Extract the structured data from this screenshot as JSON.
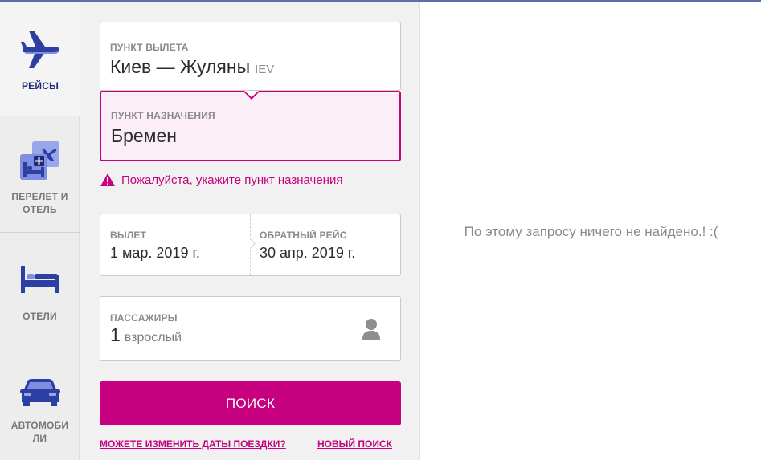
{
  "rail": {
    "tabs": [
      {
        "label": "РЕЙСЫ",
        "icon": "airplane-icon",
        "active": true
      },
      {
        "label": "ПЕРЕЛЕТ И ОТЕЛЬ",
        "icon": "flight-hotel-icon",
        "active": false
      },
      {
        "label": "ОТЕЛИ",
        "icon": "bed-icon",
        "active": false
      },
      {
        "label": "АВТОМОБИ ЛИ",
        "icon": "car-icon",
        "active": false
      }
    ]
  },
  "form": {
    "origin": {
      "label": "ПУНКТ ВЫЛЕТА",
      "value": "Киев — Жуляны",
      "code": "IEV"
    },
    "destination": {
      "label": "ПУНКТ НАЗНАЧЕНИЯ",
      "value": "Бремен"
    },
    "error": {
      "text": "Пожалуйста, укажите пункт назначения",
      "icon": "warning-icon"
    },
    "departure": {
      "label": "ВЫЛЕТ",
      "value": "1 мар. 2019 г."
    },
    "return": {
      "label": "ОБРАТНЫЙ РЕЙС",
      "value": "30 апр. 2019 г."
    },
    "passengers": {
      "label": "ПАССАЖИРЫ",
      "count": "1",
      "unit": "взрослый",
      "icon": "person-icon"
    },
    "search_label": "ПОИСК",
    "change_dates_link": "МОЖЕТЕ ИЗМЕНИТЬ ДАТЫ ПОЕЗДКИ?",
    "new_search_link": "НОВЫЙ ПОИСК"
  },
  "results": {
    "message": "По этому запросу ничего не найдено.! :("
  },
  "colors": {
    "accent": "#c6007e",
    "navy": "#1a2a78",
    "icon_blue": "#2e3fa3",
    "icon_light": "#7f8ee0"
  }
}
